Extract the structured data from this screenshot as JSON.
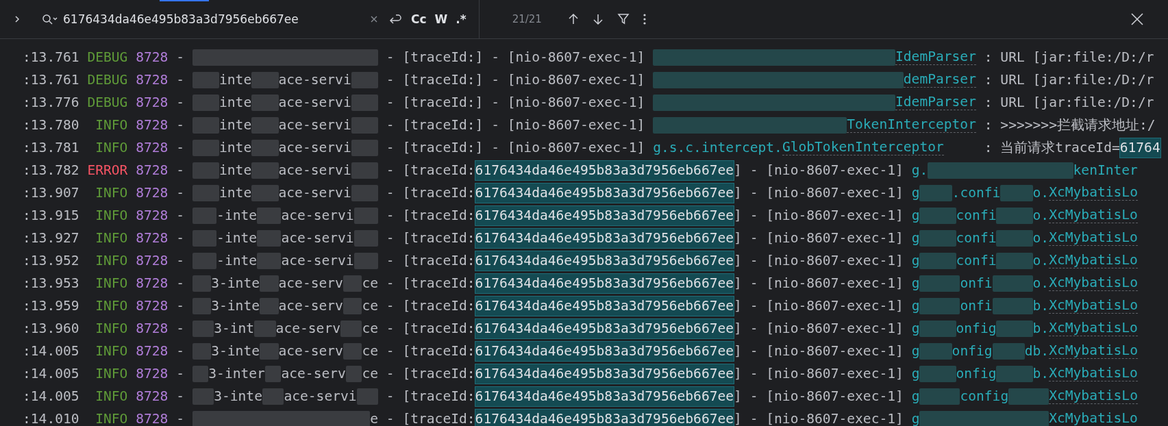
{
  "find_bar": {
    "query": "6176434da46e495b83a3d7956eb667ee",
    "options": [
      {
        "label": "Cc",
        "selected": false
      },
      {
        "label": "W",
        "selected": false
      },
      {
        "label": ".*",
        "selected": false
      }
    ],
    "match_count": "21/21"
  },
  "log_rows": [
    {
      "time": ":13.761",
      "level": "DEBUG",
      "pid": "8728",
      "dash": "-",
      "service": [
        {
          "kind": "blur"
        }
      ],
      "trace": [
        {
          "kind": "text",
          "text": "- [traceId:]"
        }
      ],
      "thread": "- [nio-8607-exec-1]",
      "logger": [
        {
          "kind": "blur"
        },
        {
          "kind": "link",
          "text": "IdemParser"
        }
      ],
      "message": [
        {
          "kind": "text",
          "text": ": URL [jar:file:/D:/r"
        }
      ]
    },
    {
      "time": ":13.761",
      "level": "DEBUG",
      "pid": "8728",
      "dash": "-",
      "service": [
        {
          "kind": "blur"
        },
        {
          "kind": "text",
          "text": "inte"
        },
        {
          "kind": "blur"
        },
        {
          "kind": "text",
          "text": "ace-servi"
        },
        {
          "kind": "blur"
        }
      ],
      "trace": [
        {
          "kind": "text",
          "text": "- [traceId:]"
        }
      ],
      "thread": "- [nio-8607-exec-1]",
      "logger": [
        {
          "kind": "blur"
        },
        {
          "kind": "link",
          "text": "demParser"
        }
      ],
      "message": [
        {
          "kind": "text",
          "text": ": URL [jar:file:/D:/r"
        }
      ]
    },
    {
      "time": ":13.776",
      "level": "DEBUG",
      "pid": "8728",
      "dash": "-",
      "service": [
        {
          "kind": "blur"
        },
        {
          "kind": "text",
          "text": "inte"
        },
        {
          "kind": "blur"
        },
        {
          "kind": "text",
          "text": "ace-servi"
        },
        {
          "kind": "blur"
        }
      ],
      "trace": [
        {
          "kind": "text",
          "text": "- [traceId:]"
        }
      ],
      "thread": "- [nio-8607-exec-1]",
      "logger": [
        {
          "kind": "blur"
        },
        {
          "kind": "link",
          "text": "IdemParser"
        }
      ],
      "message": [
        {
          "kind": "text",
          "text": ": URL [jar:file:/D:/r"
        }
      ]
    },
    {
      "time": ":13.780",
      "level": "INFO",
      "pid": "8728",
      "dash": "-",
      "service": [
        {
          "kind": "blur"
        },
        {
          "kind": "text",
          "text": "inte"
        },
        {
          "kind": "blur"
        },
        {
          "kind": "text",
          "text": "ace-servi"
        },
        {
          "kind": "blur"
        }
      ],
      "trace": [
        {
          "kind": "text",
          "text": "- [traceId:]"
        }
      ],
      "thread": "- [nio-8607-exec-1]",
      "logger": [
        {
          "kind": "blur"
        },
        {
          "kind": "link",
          "text": "TokenInterceptor"
        }
      ],
      "message": [
        {
          "kind": "text",
          "text": ": >>>>>>>拦截请求地址:/"
        }
      ]
    },
    {
      "time": ":13.781",
      "level": "INFO",
      "pid": "8728",
      "dash": "-",
      "service": [
        {
          "kind": "blur"
        },
        {
          "kind": "text",
          "text": "inte"
        },
        {
          "kind": "blur"
        },
        {
          "kind": "text",
          "text": "ace-servi"
        },
        {
          "kind": "blur"
        }
      ],
      "trace": [
        {
          "kind": "text",
          "text": "- [traceId:]"
        }
      ],
      "thread": "- [nio-8607-exec-1]",
      "logger": [
        {
          "kind": "text",
          "text": "g.s.c.intercept."
        },
        {
          "kind": "link",
          "text": "GlobTokenInterceptor"
        }
      ],
      "message": [
        {
          "kind": "text",
          "text": ": 当前请求traceId="
        },
        {
          "kind": "match",
          "text": "61764"
        }
      ]
    },
    {
      "time": ":13.782",
      "level": "ERROR",
      "pid": "8728",
      "dash": "-",
      "service": [
        {
          "kind": "blur"
        },
        {
          "kind": "text",
          "text": "inte"
        },
        {
          "kind": "blur"
        },
        {
          "kind": "text",
          "text": "ace-servi"
        },
        {
          "kind": "blur"
        }
      ],
      "trace": [
        {
          "kind": "text",
          "text": "- [traceId:"
        },
        {
          "kind": "match",
          "text": "6176434da46e495b83a3d7956eb667ee"
        },
        {
          "kind": "text",
          "text": "]"
        }
      ],
      "thread": "- [nio-8607-exec-1]",
      "logger": [
        {
          "kind": "text",
          "text": "g."
        },
        {
          "kind": "blur"
        },
        {
          "kind": "text",
          "text": "kenInter"
        }
      ]
    },
    {
      "time": ":13.907",
      "level": "INFO",
      "pid": "8728",
      "dash": "-",
      "service": [
        {
          "kind": "blur"
        },
        {
          "kind": "text",
          "text": "inte"
        },
        {
          "kind": "blur"
        },
        {
          "kind": "text",
          "text": "ace-servi"
        },
        {
          "kind": "blur"
        }
      ],
      "trace": [
        {
          "kind": "text",
          "text": "- [traceId:"
        },
        {
          "kind": "match",
          "text": "6176434da46e495b83a3d7956eb667ee"
        },
        {
          "kind": "text",
          "text": "]"
        }
      ],
      "thread": "- [nio-8607-exec-1]",
      "logger": [
        {
          "kind": "text",
          "text": "g"
        },
        {
          "kind": "blur"
        },
        {
          "kind": "text",
          "text": ".confi"
        },
        {
          "kind": "blur"
        },
        {
          "kind": "text",
          "text": "o."
        },
        {
          "kind": "link",
          "text": "XcMybatisLo"
        }
      ]
    },
    {
      "time": ":13.915",
      "level": "INFO",
      "pid": "8728",
      "dash": "-",
      "service": [
        {
          "kind": "blur"
        },
        {
          "kind": "text",
          "text": "-inte"
        },
        {
          "kind": "blur"
        },
        {
          "kind": "text",
          "text": "ace-servi"
        },
        {
          "kind": "blur"
        }
      ],
      "trace": [
        {
          "kind": "text",
          "text": "- [traceId:"
        },
        {
          "kind": "match",
          "text": "6176434da46e495b83a3d7956eb667ee"
        },
        {
          "kind": "text",
          "text": "]"
        }
      ],
      "thread": "- [nio-8607-exec-1]",
      "logger": [
        {
          "kind": "text",
          "text": "g"
        },
        {
          "kind": "blur"
        },
        {
          "kind": "text",
          "text": "confi"
        },
        {
          "kind": "blur"
        },
        {
          "kind": "text",
          "text": "o."
        },
        {
          "kind": "link",
          "text": "XcMybatisLo"
        }
      ]
    },
    {
      "time": ":13.927",
      "level": "INFO",
      "pid": "8728",
      "dash": "-",
      "service": [
        {
          "kind": "blur"
        },
        {
          "kind": "text",
          "text": "-inte"
        },
        {
          "kind": "blur"
        },
        {
          "kind": "text",
          "text": "ace-servi"
        },
        {
          "kind": "blur"
        }
      ],
      "trace": [
        {
          "kind": "text",
          "text": "- [traceId:"
        },
        {
          "kind": "match",
          "text": "6176434da46e495b83a3d7956eb667ee"
        },
        {
          "kind": "text",
          "text": "]"
        }
      ],
      "thread": "- [nio-8607-exec-1]",
      "logger": [
        {
          "kind": "text",
          "text": "g"
        },
        {
          "kind": "blur"
        },
        {
          "kind": "text",
          "text": "confi"
        },
        {
          "kind": "blur"
        },
        {
          "kind": "text",
          "text": "o."
        },
        {
          "kind": "link",
          "text": "XcMybatisLo"
        }
      ]
    },
    {
      "time": ":13.952",
      "level": "INFO",
      "pid": "8728",
      "dash": "-",
      "service": [
        {
          "kind": "blur"
        },
        {
          "kind": "text",
          "text": "-inte"
        },
        {
          "kind": "blur"
        },
        {
          "kind": "text",
          "text": "ace-servi"
        },
        {
          "kind": "blur"
        }
      ],
      "trace": [
        {
          "kind": "text",
          "text": "- [traceId:"
        },
        {
          "kind": "match",
          "text": "6176434da46e495b83a3d7956eb667ee"
        },
        {
          "kind": "text",
          "text": "]"
        }
      ],
      "thread": "- [nio-8607-exec-1]",
      "logger": [
        {
          "kind": "text",
          "text": "g"
        },
        {
          "kind": "blur"
        },
        {
          "kind": "text",
          "text": "confi"
        },
        {
          "kind": "blur"
        },
        {
          "kind": "text",
          "text": "o."
        },
        {
          "kind": "link",
          "text": "XcMybatisLo"
        }
      ]
    },
    {
      "time": ":13.953",
      "level": "INFO",
      "pid": "8728",
      "dash": "-",
      "service": [
        {
          "kind": "blur"
        },
        {
          "kind": "text",
          "text": "3-inte"
        },
        {
          "kind": "blur"
        },
        {
          "kind": "text",
          "text": "ace-serv"
        },
        {
          "kind": "blur"
        },
        {
          "kind": "text",
          "text": "ce"
        }
      ],
      "trace": [
        {
          "kind": "text",
          "text": "- [traceId:"
        },
        {
          "kind": "match",
          "text": "6176434da46e495b83a3d7956eb667ee"
        },
        {
          "kind": "text",
          "text": "]"
        }
      ],
      "thread": "- [nio-8607-exec-1]",
      "logger": [
        {
          "kind": "text",
          "text": "g"
        },
        {
          "kind": "blur"
        },
        {
          "kind": "text",
          "text": "onfi"
        },
        {
          "kind": "blur"
        },
        {
          "kind": "text",
          "text": "o."
        },
        {
          "kind": "link",
          "text": "XcMybatisLo"
        }
      ]
    },
    {
      "time": ":13.959",
      "level": "INFO",
      "pid": "8728",
      "dash": "-",
      "service": [
        {
          "kind": "blur"
        },
        {
          "kind": "text",
          "text": "3-inte"
        },
        {
          "kind": "blur"
        },
        {
          "kind": "text",
          "text": "ace-serv"
        },
        {
          "kind": "blur"
        },
        {
          "kind": "text",
          "text": "ce"
        }
      ],
      "trace": [
        {
          "kind": "text",
          "text": "- [traceId:"
        },
        {
          "kind": "match",
          "text": "6176434da46e495b83a3d7956eb667ee"
        },
        {
          "kind": "text",
          "text": "]"
        }
      ],
      "thread": "- [nio-8607-exec-1]",
      "logger": [
        {
          "kind": "text",
          "text": "g"
        },
        {
          "kind": "blur"
        },
        {
          "kind": "text",
          "text": "onfi"
        },
        {
          "kind": "blur"
        },
        {
          "kind": "text",
          "text": "b."
        },
        {
          "kind": "link",
          "text": "XcMybatisLo"
        }
      ]
    },
    {
      "time": ":13.960",
      "level": "INFO",
      "pid": "8728",
      "dash": "-",
      "service": [
        {
          "kind": "blur"
        },
        {
          "kind": "text",
          "text": "3-int"
        },
        {
          "kind": "blur"
        },
        {
          "kind": "text",
          "text": "ace-serv"
        },
        {
          "kind": "blur"
        },
        {
          "kind": "text",
          "text": "ce"
        }
      ],
      "trace": [
        {
          "kind": "text",
          "text": "- [traceId:"
        },
        {
          "kind": "match",
          "text": "6176434da46e495b83a3d7956eb667ee"
        },
        {
          "kind": "text",
          "text": "]"
        }
      ],
      "thread": "- [nio-8607-exec-1]",
      "logger": [
        {
          "kind": "text",
          "text": "g"
        },
        {
          "kind": "blur"
        },
        {
          "kind": "text",
          "text": "onfig"
        },
        {
          "kind": "blur"
        },
        {
          "kind": "text",
          "text": "b."
        },
        {
          "kind": "link",
          "text": "XcMybatisLo"
        }
      ]
    },
    {
      "time": ":14.005",
      "level": "INFO",
      "pid": "8728",
      "dash": "-",
      "service": [
        {
          "kind": "blur"
        },
        {
          "kind": "text",
          "text": "3-inte"
        },
        {
          "kind": "blur"
        },
        {
          "kind": "text",
          "text": "ace-serv"
        },
        {
          "kind": "blur"
        },
        {
          "kind": "text",
          "text": "ce"
        }
      ],
      "trace": [
        {
          "kind": "text",
          "text": "- [traceId:"
        },
        {
          "kind": "match",
          "text": "6176434da46e495b83a3d7956eb667ee"
        },
        {
          "kind": "text",
          "text": "]"
        }
      ],
      "thread": "- [nio-8607-exec-1]",
      "logger": [
        {
          "kind": "text",
          "text": "g"
        },
        {
          "kind": "blur"
        },
        {
          "kind": "text",
          "text": "onfig"
        },
        {
          "kind": "blur"
        },
        {
          "kind": "text",
          "text": "db."
        },
        {
          "kind": "link",
          "text": "XcMybatisLo"
        }
      ]
    },
    {
      "time": ":14.005",
      "level": "INFO",
      "pid": "8728",
      "dash": "-",
      "service": [
        {
          "kind": "blur"
        },
        {
          "kind": "text",
          "text": "3-inter"
        },
        {
          "kind": "blur"
        },
        {
          "kind": "text",
          "text": "ace-serv"
        },
        {
          "kind": "blur"
        },
        {
          "kind": "text",
          "text": "ce"
        }
      ],
      "trace": [
        {
          "kind": "text",
          "text": "- [traceId:"
        },
        {
          "kind": "match",
          "text": "6176434da46e495b83a3d7956eb667ee"
        },
        {
          "kind": "text",
          "text": "]"
        }
      ],
      "thread": "- [nio-8607-exec-1]",
      "logger": [
        {
          "kind": "text",
          "text": "g"
        },
        {
          "kind": "blur"
        },
        {
          "kind": "text",
          "text": "onfig"
        },
        {
          "kind": "blur"
        },
        {
          "kind": "text",
          "text": "b."
        },
        {
          "kind": "link",
          "text": "XcMybatisLo"
        }
      ]
    },
    {
      "time": ":14.005",
      "level": "INFO",
      "pid": "8728",
      "dash": "-",
      "service": [
        {
          "kind": "blur"
        },
        {
          "kind": "text",
          "text": "3-inte"
        },
        {
          "kind": "blur"
        },
        {
          "kind": "text",
          "text": "ace-servi"
        },
        {
          "kind": "blur"
        }
      ],
      "trace": [
        {
          "kind": "text",
          "text": "- [traceId:"
        },
        {
          "kind": "match",
          "text": "6176434da46e495b83a3d7956eb667ee"
        },
        {
          "kind": "text",
          "text": "]"
        }
      ],
      "thread": "- [nio-8607-exec-1]",
      "logger": [
        {
          "kind": "text",
          "text": "g"
        },
        {
          "kind": "blur"
        },
        {
          "kind": "text",
          "text": "config"
        },
        {
          "kind": "blur"
        },
        {
          "kind": "link",
          "text": "XcMybatisLo"
        }
      ]
    },
    {
      "time": ":14.010",
      "level": "INFO",
      "pid": "8728",
      "dash": "-",
      "service": [
        {
          "kind": "blur"
        },
        {
          "kind": "text",
          "text": "e"
        }
      ],
      "trace": [
        {
          "kind": "text",
          "text": "- [traceId:"
        },
        {
          "kind": "match",
          "text": "6176434da46e495b83a3d7956eb667ee"
        },
        {
          "kind": "text",
          "text": "]"
        }
      ],
      "thread": "- [nio-8607-exec-1]",
      "logger": [
        {
          "kind": "text",
          "text": "g"
        },
        {
          "kind": "blur"
        },
        {
          "kind": "link",
          "text": "XcMybatisLo"
        }
      ]
    }
  ]
}
